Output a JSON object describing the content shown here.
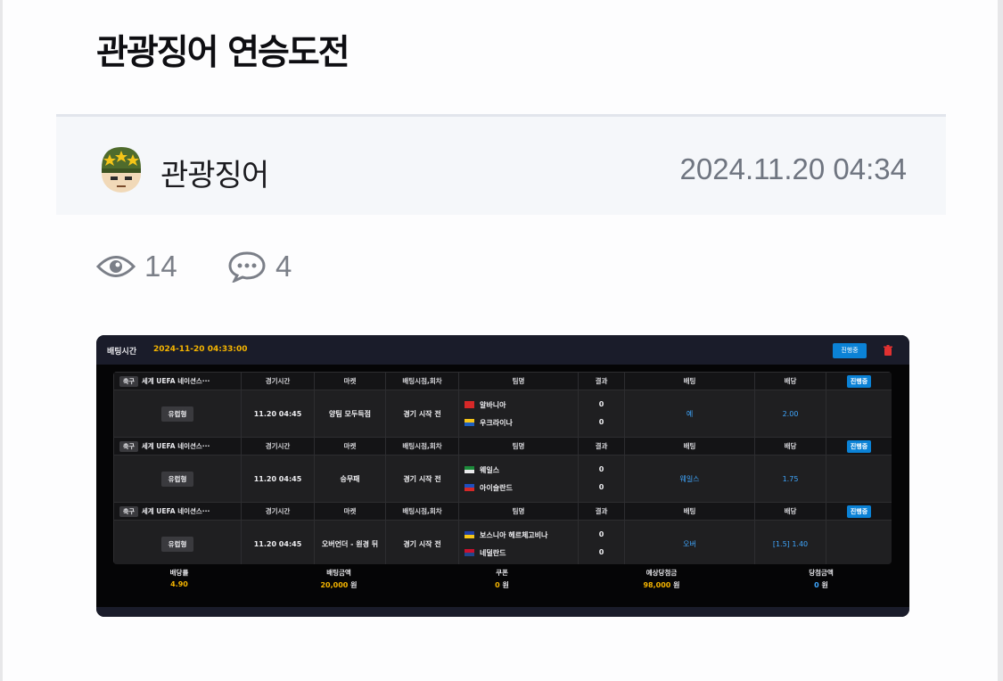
{
  "post": {
    "title": "관광징어 연승도전",
    "author": "관광징어",
    "date": "2024.11.20 04:34",
    "views": "14",
    "comments": "4"
  },
  "icons": {
    "avatar": "soldier-avatar-icon",
    "views": "eye-icon",
    "comments": "speech-bubble-icon",
    "delete": "trash-icon"
  },
  "colors": {
    "accent_gold": "#f4b400",
    "accent_blue": "#3fa7ff",
    "status_blue": "#0b82d6"
  },
  "slip": {
    "header_label": "배팅시간",
    "header_time": "2024-11-20 04:33:00",
    "status_label": "진행중",
    "columns": [
      "경기시간",
      "마켓",
      "배팅시점,회차",
      "팀명",
      "결과",
      "배팅",
      "배당"
    ],
    "bets": [
      {
        "sport": "축구",
        "league": "세계 UEFA 네이션스···",
        "status": "진행중",
        "type": "유럽형",
        "time": "11.20 04:45",
        "market": "양팀 모두득점",
        "point": "경기 시작 전",
        "home": "알바니아",
        "away": "우크라이나",
        "home_score": "0",
        "away_score": "0",
        "pick": "예",
        "odds": "2.00"
      },
      {
        "sport": "축구",
        "league": "세계 UEFA 네이션스···",
        "status": "진행중",
        "type": "유럽형",
        "time": "11.20 04:45",
        "market": "승무패",
        "point": "경기 시작 전",
        "home": "웨일스",
        "away": "아이슬란드",
        "home_score": "0",
        "away_score": "0",
        "pick": "웨일스",
        "odds": "1.75"
      },
      {
        "sport": "축구",
        "league": "세계 UEFA 네이션스···",
        "status": "진행중",
        "type": "유럽형",
        "time": "11.20 04:45",
        "market": "오버언더 - 원경 뒤",
        "point": "경기 시작 전",
        "home": "보스니아 헤르체고비나",
        "away": "네덜란드",
        "home_score": "0",
        "away_score": "0",
        "pick": "오버",
        "odds": "[1.5] 1.40"
      }
    ],
    "summary": [
      {
        "label": "배당률",
        "value": "4.90",
        "unit": ""
      },
      {
        "label": "배팅금액",
        "value": "20,000",
        "unit": "원"
      },
      {
        "label": "쿠폰",
        "value": "0",
        "unit": "원"
      },
      {
        "label": "예상당첨금",
        "value": "98,000",
        "unit": "원"
      },
      {
        "label": "당첨금액",
        "value": "0",
        "unit": "원"
      }
    ]
  }
}
